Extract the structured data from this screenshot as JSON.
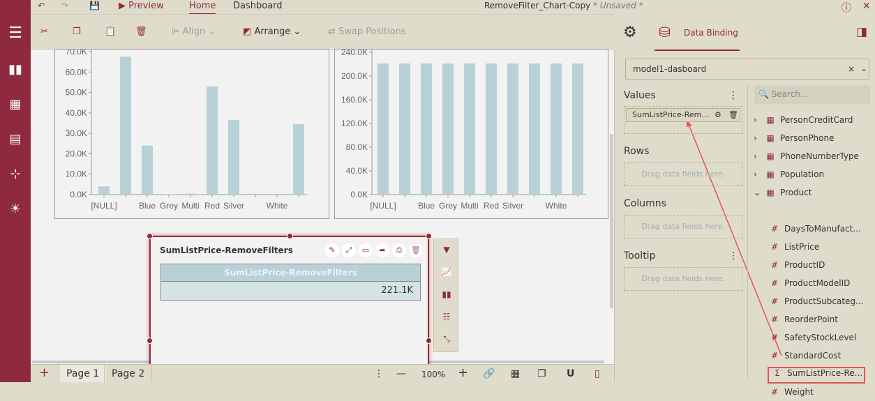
{
  "topbar": {
    "preview": "Preview",
    "tabs": [
      "Home",
      "Dashboard"
    ],
    "title": "RemoveFilter_Chart-Copy",
    "status": "* Unsaved *"
  },
  "toolbar": {
    "align": "Align",
    "arrange": "Arrange",
    "swap": "Swap Positions"
  },
  "colors": {
    "accent": "#8f2a3e",
    "bar": "#b7d1d6",
    "canvas": "#f2f2f2",
    "chrome": "#e0dccc"
  },
  "chart_data": [
    {
      "type": "bar",
      "categories": [
        "[NULL]",
        "",
        "Blue",
        "Grey",
        "Multi",
        "Red",
        "Silver",
        "",
        "White",
        ""
      ],
      "values": [
        4000,
        67500,
        24000,
        200,
        500,
        53000,
        36500,
        400,
        0,
        34500
      ],
      "ylim": [
        0,
        70000
      ],
      "yticks": [
        "0.0K",
        "10.0K",
        "20.0K",
        "30.0K",
        "40.0K",
        "50.0K",
        "60.0K",
        "70.0K"
      ],
      "ytick_values": [
        0,
        10000,
        20000,
        30000,
        40000,
        50000,
        60000,
        70000
      ]
    },
    {
      "type": "bar",
      "categories": [
        "[NULL]",
        "",
        "Blue",
        "Grey",
        "Multi",
        "Red",
        "Silver",
        "",
        "White",
        ""
      ],
      "values": [
        221100,
        221100,
        221100,
        221100,
        221100,
        221100,
        221100,
        221100,
        221100,
        221100
      ],
      "ylim": [
        0,
        240000
      ],
      "yticks": [
        "0.0K",
        "40.0K",
        "80.0K",
        "120.0K",
        "160.0K",
        "200.0K",
        "240.0K"
      ],
      "ytick_values": [
        0,
        40000,
        80000,
        120000,
        160000,
        200000,
        240000
      ]
    }
  ],
  "widget": {
    "title": "SumListPrice-RemoveFilters",
    "header": "SumListPrice-RemoveFilters",
    "value": "221.1K"
  },
  "bottom": {
    "pages": [
      "Page 1",
      "Page 2"
    ],
    "zoom": "100%"
  },
  "panel": {
    "tab": "Data Binding",
    "datasource": "model1-dasboard",
    "search_placeholder": "Search...",
    "sections": {
      "values": "Values",
      "rows": "Rows",
      "columns": "Columns",
      "tooltip": "Tooltip"
    },
    "value_field": "SumListPrice-Rem...",
    "drop_hint": "Drag data fields here.",
    "tables": [
      "PersonCreditCard",
      "PersonPhone",
      "PhoneNumberType",
      "Population",
      "Product"
    ],
    "fields": [
      {
        "icon": "#",
        "name": "DaysToManufact..."
      },
      {
        "icon": "#",
        "name": "ListPrice"
      },
      {
        "icon": "#",
        "name": "ProductID"
      },
      {
        "icon": "#",
        "name": "ProductModelID"
      },
      {
        "icon": "#",
        "name": "ProductSubcateg..."
      },
      {
        "icon": "#",
        "name": "ReorderPoint"
      },
      {
        "icon": "#",
        "name": "SafetyStockLevel"
      },
      {
        "icon": "#",
        "name": "StandardCost"
      },
      {
        "icon": "Σ",
        "name": "SumListPrice-Re..."
      },
      {
        "icon": "#",
        "name": "Weight"
      }
    ]
  }
}
